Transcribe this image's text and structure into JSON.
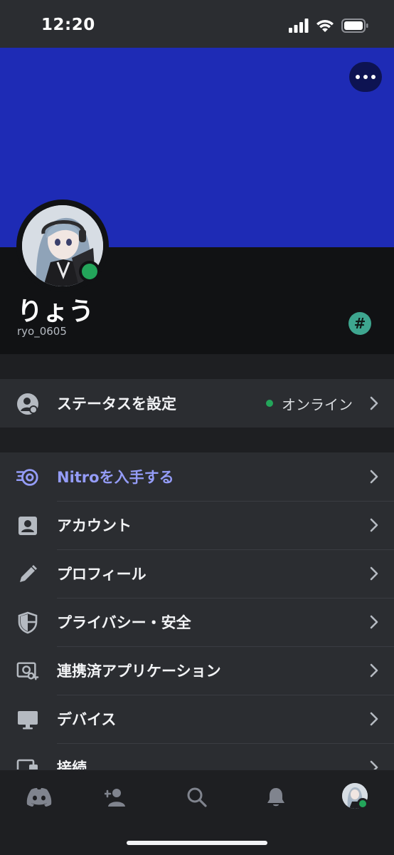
{
  "status_bar": {
    "time": "12:20"
  },
  "colors": {
    "banner": "#1e2bb5",
    "accent": "#949cf7",
    "online": "#23a55a",
    "badge": "#3ea68f"
  },
  "profile": {
    "display_name": "りょう",
    "username": "ryo_0605",
    "badge": "#"
  },
  "status_row": {
    "label": "ステータスを設定",
    "value": "オンライン",
    "icon": "status-person-icon"
  },
  "settings": [
    {
      "label": "Nitroを入手する",
      "icon": "nitro-icon"
    },
    {
      "label": "アカウント",
      "icon": "account-icon"
    },
    {
      "label": "プロフィール",
      "icon": "pencil-icon"
    },
    {
      "label": "プライバシー・安全",
      "icon": "shield-icon"
    },
    {
      "label": "連携済アプリケーション",
      "icon": "authorized-apps-icon"
    },
    {
      "label": "デバイス",
      "icon": "monitor-icon"
    },
    {
      "label": "接続",
      "icon": "connections-icon"
    }
  ],
  "tabbar": [
    "discord-home-icon",
    "friends-icon",
    "search-icon",
    "bell-icon",
    "profile-avatar"
  ]
}
